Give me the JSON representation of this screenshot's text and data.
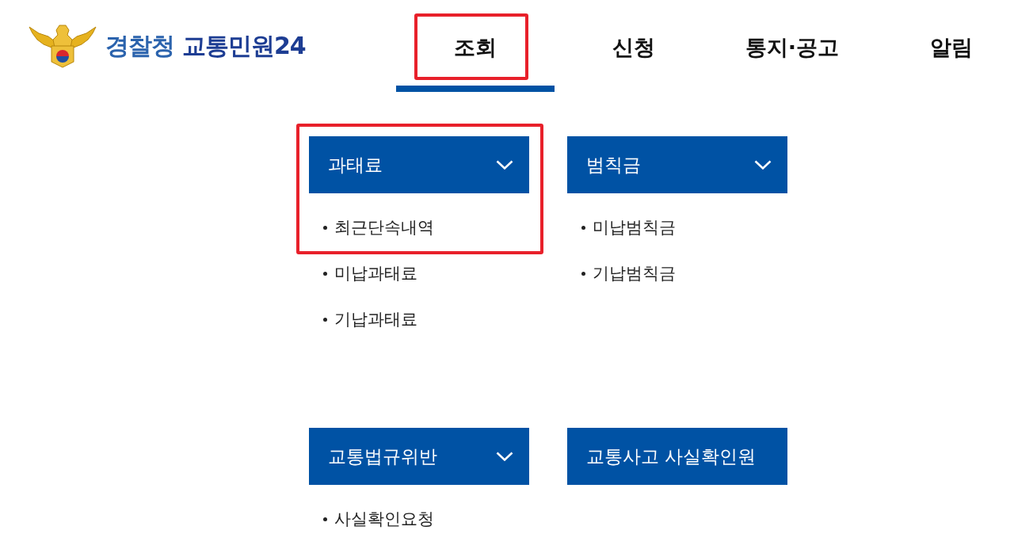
{
  "logo": {
    "org": "경찰청",
    "service": "교통민원24"
  },
  "nav": {
    "tabs": [
      {
        "label": "조회",
        "selected": true,
        "highlighted": true
      },
      {
        "label": "신청",
        "selected": false,
        "highlighted": false
      },
      {
        "label": "통지·공고",
        "selected": false,
        "highlighted": false
      },
      {
        "label": "알림",
        "selected": false,
        "highlighted": false
      }
    ]
  },
  "menu_groups": [
    {
      "title": "과태료",
      "expandable": true,
      "highlighted": true,
      "items": [
        {
          "label": "최근단속내역",
          "highlighted": true
        },
        {
          "label": "미납과태료",
          "highlighted": false
        },
        {
          "label": "기납과태료",
          "highlighted": false
        }
      ]
    },
    {
      "title": "범칙금",
      "expandable": true,
      "highlighted": false,
      "items": [
        {
          "label": "미납범칙금",
          "highlighted": false
        },
        {
          "label": "기납범칙금",
          "highlighted": false
        }
      ]
    },
    {
      "title": "교통법규위반",
      "expandable": true,
      "highlighted": false,
      "items": [
        {
          "label": "사실확인요청",
          "highlighted": false
        }
      ]
    },
    {
      "title": "교통사고 사실확인원",
      "expandable": false,
      "highlighted": false
    }
  ]
}
